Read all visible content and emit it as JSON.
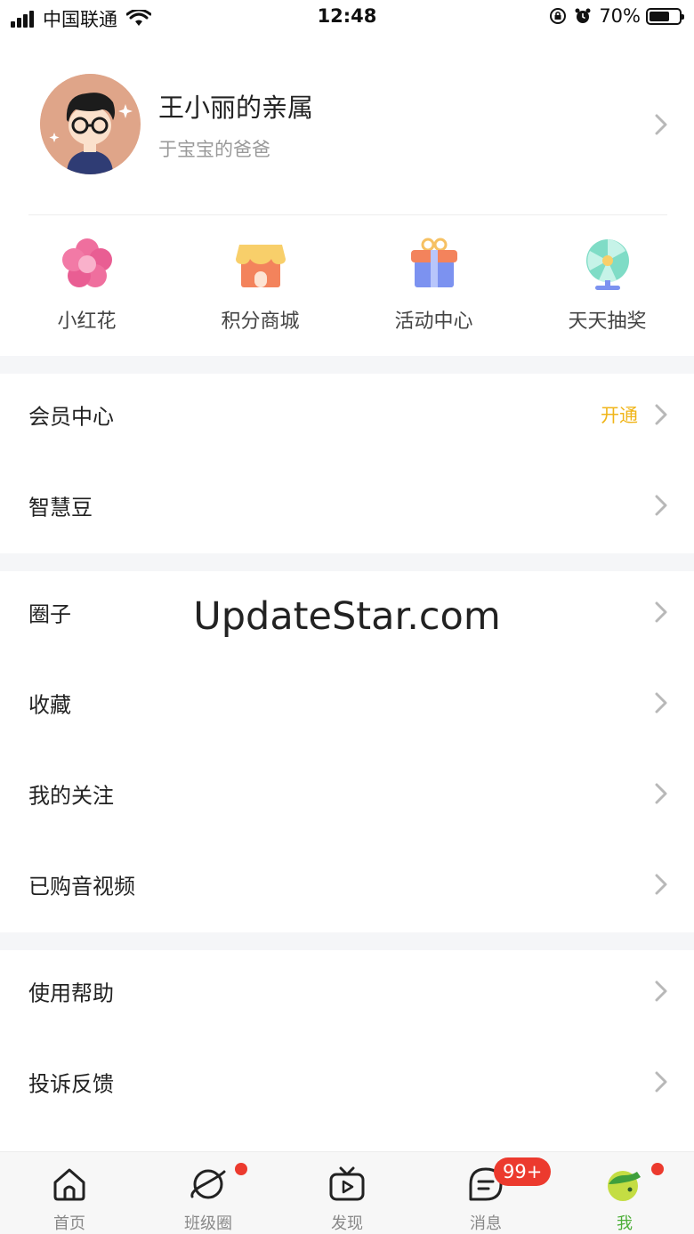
{
  "status_bar": {
    "carrier": "中国联通",
    "time": "12:48",
    "battery": "70%",
    "battery_level": 0.7
  },
  "profile": {
    "name": "王小丽的亲属",
    "subtitle": "于宝宝的爸爸",
    "avatar_icon": "cartoon-boy-avatar"
  },
  "quick_actions": [
    {
      "label": "小红花",
      "icon": "flower-icon"
    },
    {
      "label": "积分商城",
      "icon": "shop-icon"
    },
    {
      "label": "活动中心",
      "icon": "gift-icon"
    },
    {
      "label": "天天抽奖",
      "icon": "lottery-wheel-icon"
    }
  ],
  "menu": {
    "group1": [
      {
        "label": "会员中心",
        "extra": "开通"
      },
      {
        "label": "智慧豆"
      }
    ],
    "group2": [
      {
        "label": "圈子"
      },
      {
        "label": "收藏"
      },
      {
        "label": "我的关注"
      },
      {
        "label": "已购音视频"
      }
    ],
    "group3": [
      {
        "label": "使用帮助"
      },
      {
        "label": "投诉反馈"
      }
    ]
  },
  "watermark": "UpdateStar.com",
  "tab_bar": {
    "tabs": [
      {
        "label": "首页",
        "icon": "home-icon"
      },
      {
        "label": "班级圈",
        "icon": "planet-icon",
        "dot": true
      },
      {
        "label": "发现",
        "icon": "tv-play-icon"
      },
      {
        "label": "消息",
        "icon": "chat-icon",
        "badge": "99+"
      },
      {
        "label": "我",
        "icon": "me-icon",
        "dot": true,
        "active": true
      }
    ]
  },
  "colors": {
    "accent_yellow": "#f0b51a",
    "active_green": "#4cae38",
    "badge_red": "#ec3a2e",
    "section_gap": "#f5f6f8"
  }
}
